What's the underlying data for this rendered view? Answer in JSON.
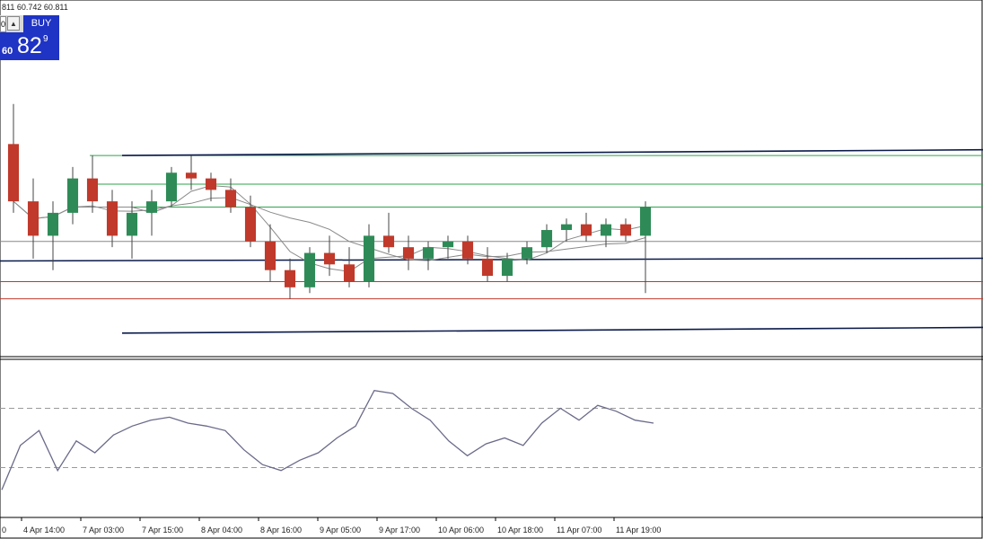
{
  "header": {
    "ohlc_text": "811 60.742 60.811"
  },
  "trade_panel": {
    "lot_value": "0",
    "arrow_symbol": "▲",
    "buy_label": "BUY",
    "price_small": "60",
    "price_big": "82",
    "price_sup": "9"
  },
  "colors": {
    "candle_up": "#2e8b57",
    "candle_down": "#c0392b",
    "wick": "#444444",
    "channel_line": "#0a1a4a",
    "green_level": "#2ca64a",
    "red_level": "#c0392b",
    "horizontal_gray": "#888888",
    "ma": "#8a8a8a",
    "rsi_line": "#6a6a8a",
    "rsi_level": "#999999",
    "buy_bg": "#1f33c4"
  },
  "chart_data": {
    "type": "candlestick",
    "title": "",
    "x_tick_labels": [
      "0",
      "4 Apr 14:00",
      "7 Apr 03:00",
      "7 Apr 15:00",
      "8 Apr 04:00",
      "8 Apr 16:00",
      "9 Apr 05:00",
      "9 Apr 17:00",
      "10 Apr 06:00",
      "10 Apr 18:00",
      "11 Apr 07:00",
      "11 Apr 19:00"
    ],
    "price_range": [
      58.6,
      61.5
    ],
    "candles": [
      {
        "o": 60.4,
        "h": 60.75,
        "l": 59.8,
        "c": 59.9
      },
      {
        "o": 59.9,
        "h": 60.1,
        "l": 59.4,
        "c": 59.6
      },
      {
        "o": 59.6,
        "h": 59.9,
        "l": 59.3,
        "c": 59.8
      },
      {
        "o": 59.8,
        "h": 60.2,
        "l": 59.7,
        "c": 60.1
      },
      {
        "o": 60.1,
        "h": 60.3,
        "l": 59.8,
        "c": 59.9
      },
      {
        "o": 59.9,
        "h": 60.0,
        "l": 59.5,
        "c": 59.6
      },
      {
        "o": 59.6,
        "h": 59.9,
        "l": 59.4,
        "c": 59.8
      },
      {
        "o": 59.8,
        "h": 60.0,
        "l": 59.6,
        "c": 59.9
      },
      {
        "o": 59.9,
        "h": 60.2,
        "l": 59.85,
        "c": 60.15
      },
      {
        "o": 60.15,
        "h": 60.3,
        "l": 60.0,
        "c": 60.1
      },
      {
        "o": 60.1,
        "h": 60.15,
        "l": 59.9,
        "c": 60.0
      },
      {
        "o": 60.0,
        "h": 60.1,
        "l": 59.8,
        "c": 59.85
      },
      {
        "o": 59.85,
        "h": 59.95,
        "l": 59.5,
        "c": 59.55
      },
      {
        "o": 59.55,
        "h": 59.7,
        "l": 59.2,
        "c": 59.3
      },
      {
        "o": 59.3,
        "h": 59.4,
        "l": 59.05,
        "c": 59.15
      },
      {
        "o": 59.15,
        "h": 59.5,
        "l": 59.1,
        "c": 59.45
      },
      {
        "o": 59.45,
        "h": 59.6,
        "l": 59.25,
        "c": 59.35
      },
      {
        "o": 59.35,
        "h": 59.5,
        "l": 59.15,
        "c": 59.2
      },
      {
        "o": 59.2,
        "h": 59.7,
        "l": 59.15,
        "c": 59.6
      },
      {
        "o": 59.6,
        "h": 59.8,
        "l": 59.45,
        "c": 59.5
      },
      {
        "o": 59.5,
        "h": 59.6,
        "l": 59.3,
        "c": 59.4
      },
      {
        "o": 59.4,
        "h": 59.55,
        "l": 59.3,
        "c": 59.5
      },
      {
        "o": 59.5,
        "h": 59.6,
        "l": 59.4,
        "c": 59.55
      },
      {
        "o": 59.55,
        "h": 59.6,
        "l": 59.35,
        "c": 59.4
      },
      {
        "o": 59.4,
        "h": 59.5,
        "l": 59.2,
        "c": 59.25
      },
      {
        "o": 59.25,
        "h": 59.45,
        "l": 59.2,
        "c": 59.4
      },
      {
        "o": 59.4,
        "h": 59.55,
        "l": 59.35,
        "c": 59.5
      },
      {
        "o": 59.5,
        "h": 59.7,
        "l": 59.45,
        "c": 59.65
      },
      {
        "o": 59.65,
        "h": 59.75,
        "l": 59.55,
        "c": 59.7
      },
      {
        "o": 59.7,
        "h": 59.8,
        "l": 59.55,
        "c": 59.6
      },
      {
        "o": 59.6,
        "h": 59.75,
        "l": 59.5,
        "c": 59.7
      },
      {
        "o": 59.7,
        "h": 59.75,
        "l": 59.55,
        "c": 59.6
      },
      {
        "o": 59.6,
        "h": 59.9,
        "l": 59.1,
        "c": 59.85
      }
    ],
    "channel": {
      "upper": {
        "start": {
          "t": 6,
          "price": 60.3
        },
        "end": {
          "t": 33,
          "price": 60.35
        }
      },
      "lower": {
        "start": {
          "t": 6,
          "price": 58.75
        },
        "end": {
          "t": 33,
          "price": 58.8
        }
      }
    },
    "support_resistance": {
      "green": [
        60.3,
        60.05,
        59.85
      ],
      "red": [
        59.2,
        59.05
      ],
      "blue": [
        59.38
      ],
      "gray": [
        59.55
      ]
    },
    "rsi": {
      "levels": [
        70,
        30
      ],
      "range": [
        0,
        100
      ],
      "values": [
        15,
        45,
        55,
        28,
        48,
        40,
        52,
        58,
        62,
        64,
        60,
        58,
        55,
        42,
        32,
        28,
        35,
        40,
        50,
        58,
        82,
        80,
        70,
        62,
        48,
        38,
        46,
        50,
        45,
        60,
        70,
        62,
        72,
        68,
        62,
        60
      ]
    }
  }
}
